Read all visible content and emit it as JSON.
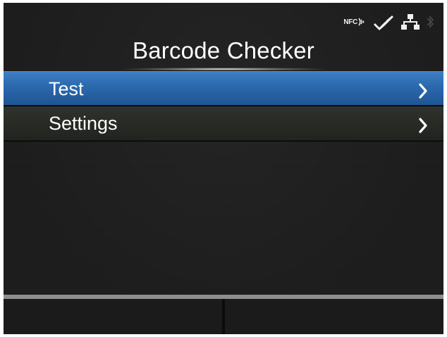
{
  "header": {
    "title": "Barcode Checker",
    "status_icons": {
      "nfc_label": "NFC",
      "nfc": "nfc-icon",
      "checker": "barcode-checker-icon",
      "network": "network-icon",
      "bluetooth": "bluetooth-icon"
    }
  },
  "menu": {
    "items": [
      {
        "label": "Test",
        "selected": true
      },
      {
        "label": "Settings",
        "selected": false
      }
    ]
  },
  "colors": {
    "selected": "#2a68ad",
    "background": "#1c1c1c",
    "text": "#ffffff"
  }
}
